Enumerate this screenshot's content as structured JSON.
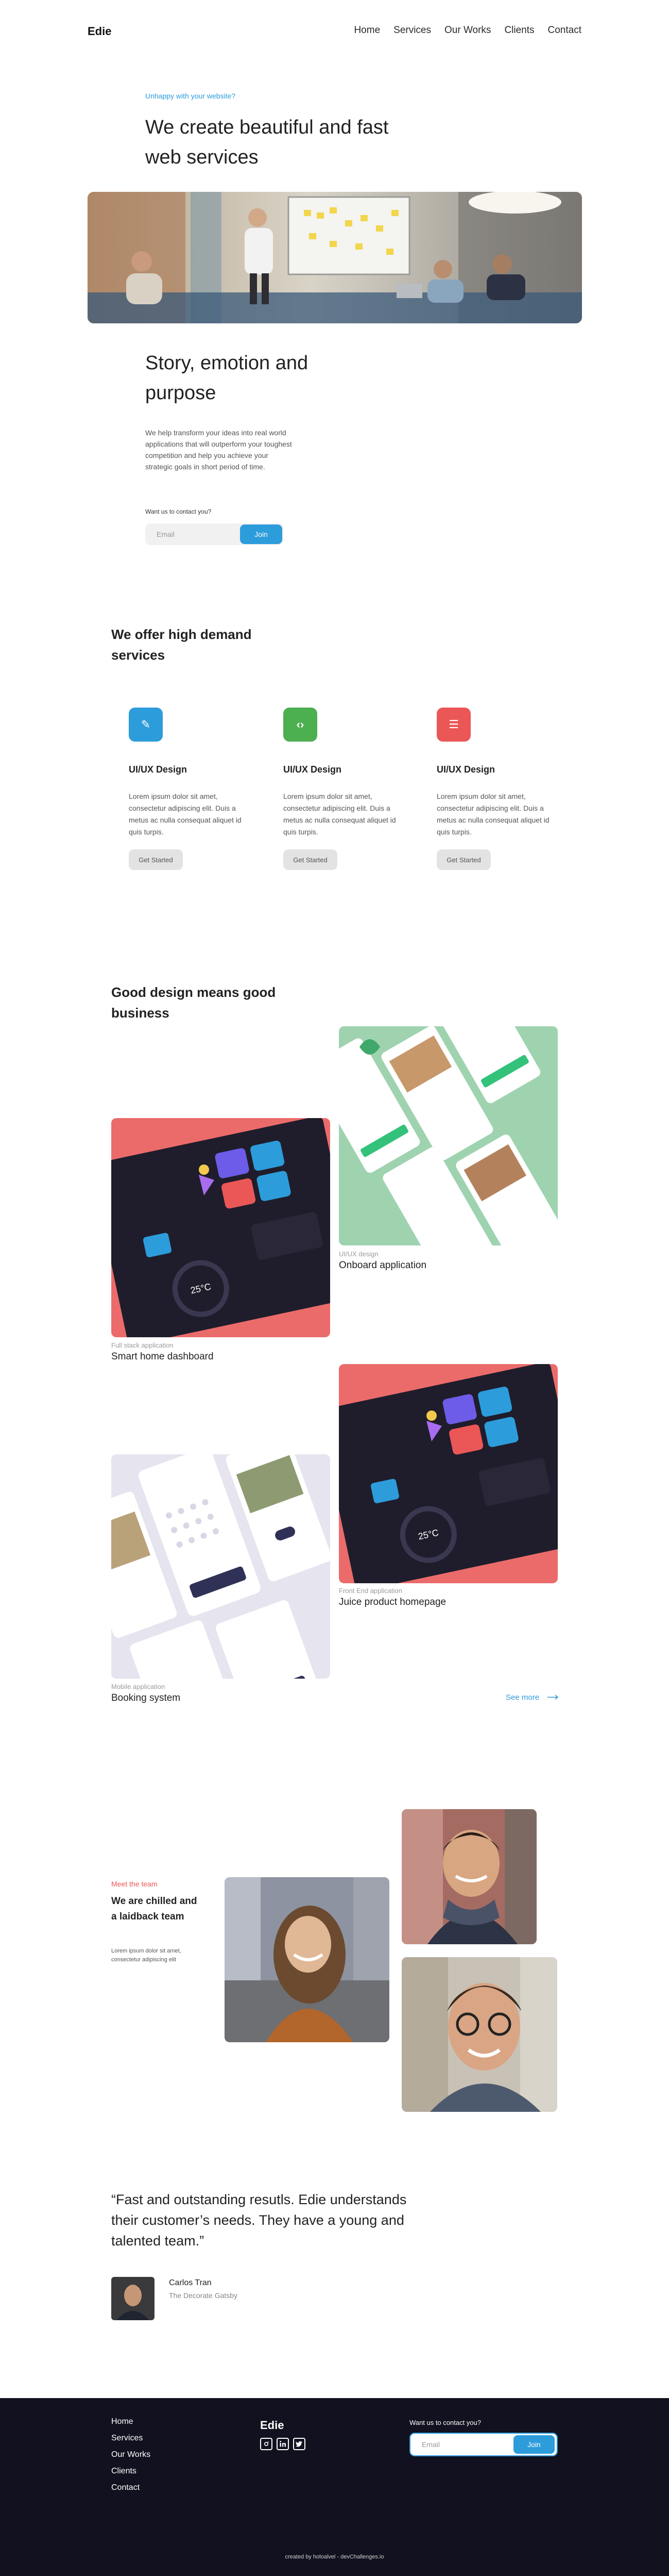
{
  "header": {
    "logo": "Edie",
    "nav": [
      "Home",
      "Services",
      "Our Works",
      "Clients",
      "Contact"
    ]
  },
  "hero": {
    "eyebrow": "Unhappy with your website?",
    "title": "We create beautiful and fast web services"
  },
  "story": {
    "title": "Story, emotion and purpose",
    "text": "We help transform your ideas into real world applications that will outperform your toughest competition and help you achieve your strategic goals in short period of time.",
    "contact_label": "Want us to contact you?",
    "email_placeholder": "Email",
    "join_label": "Join"
  },
  "services": {
    "title": "We offer high demand services",
    "items": [
      {
        "icon": "pencil-icon",
        "glyph": "✎",
        "color": "#2d9cdb",
        "title": "UI/UX Design",
        "text": "Lorem ipsum dolor sit amet, consectetur adipiscing elit. Duis a metus ac nulla consequat aliquet id quis turpis.",
        "button": "Get Started"
      },
      {
        "icon": "code-icon",
        "glyph": "‹›",
        "color": "#4caf50",
        "title": "UI/UX Design",
        "text": "Lorem ipsum dolor sit amet, consectetur adipiscing elit. Duis a metus ac nulla consequat aliquet id quis turpis.",
        "button": "Get Started"
      },
      {
        "icon": "list-icon",
        "glyph": "☰",
        "color": "#eb5757",
        "title": "UI/UX Design",
        "text": "Lorem ipsum dolor sit amet, consectetur adipiscing elit. Duis a metus ac nulla consequat aliquet id quis turpis.",
        "button": "Get Started"
      }
    ]
  },
  "works": {
    "title": "Good design means good business",
    "items": [
      {
        "category": "UI/UX design",
        "name": "Onboard application"
      },
      {
        "category": "Full stack application",
        "name": "Smart home dashboard"
      },
      {
        "category": "Front End application",
        "name": "Juice product homepage"
      },
      {
        "category": "Mobile application",
        "name": "Booking system"
      }
    ],
    "see_more": "See more"
  },
  "team": {
    "eyebrow": "Meet the team",
    "title": "We are chilled and a laidback team",
    "text": "Lorem ipsum dolor sit amet, consectetur adipiscing elit"
  },
  "testimonial": {
    "quote": "“Fast and outstanding resutls. Edie understands their customer’s needs. They have a young and talented team.”",
    "name": "Carlos Tran",
    "role": "The Decorate Gatsby"
  },
  "footer": {
    "links": [
      "Home",
      "Services",
      "Our Works",
      "Clients",
      "Contact"
    ],
    "logo": "Edie",
    "social": [
      "instagram-icon",
      "linkedin-icon",
      "twitter-icon"
    ],
    "contact_label": "Want us to contact you?",
    "email_placeholder": "Email",
    "join_label": "Join",
    "credit": "created by holoalvel - devChallenges.io"
  }
}
